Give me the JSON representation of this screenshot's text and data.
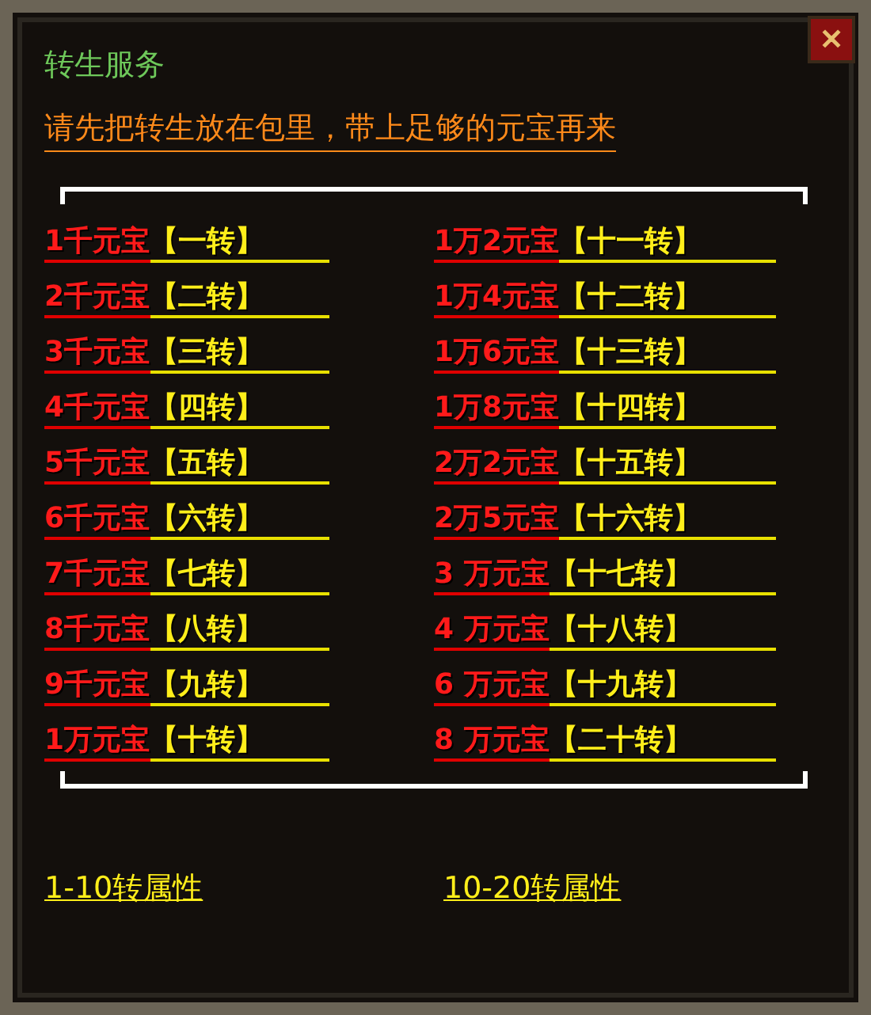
{
  "window": {
    "title": "转生服务",
    "close": "✕"
  },
  "notice": "请先把转生放在包里，带上足够的元宝再来",
  "columns": [
    [
      {
        "price": "1千元宝",
        "tier": "【一转】"
      },
      {
        "price": "2千元宝",
        "tier": "【二转】"
      },
      {
        "price": "3千元宝",
        "tier": "【三转】"
      },
      {
        "price": "4千元宝",
        "tier": "【四转】"
      },
      {
        "price": "5千元宝",
        "tier": "【五转】"
      },
      {
        "price": "6千元宝",
        "tier": "【六转】"
      },
      {
        "price": "7千元宝",
        "tier": "【七转】"
      },
      {
        "price": "8千元宝",
        "tier": "【八转】"
      },
      {
        "price": "9千元宝",
        "tier": "【九转】"
      },
      {
        "price": "1万元宝",
        "tier": "【十转】"
      }
    ],
    [
      {
        "price": "1万2元宝",
        "tier": "【十一转】"
      },
      {
        "price": "1万4元宝",
        "tier": "【十二转】"
      },
      {
        "price": "1万6元宝",
        "tier": "【十三转】"
      },
      {
        "price": "1万8元宝",
        "tier": "【十四转】"
      },
      {
        "price": "2万2元宝",
        "tier": "【十五转】"
      },
      {
        "price": "2万5元宝",
        "tier": "【十六转】"
      },
      {
        "price": "3 万元宝",
        "tier": "【十七转】"
      },
      {
        "price": "4 万元宝",
        "tier": "【十八转】"
      },
      {
        "price": "6 万元宝",
        "tier": "【十九转】"
      },
      {
        "price": "8 万元宝",
        "tier": "【二十转】"
      }
    ]
  ],
  "attribute_links": [
    "1-10转属性",
    "10-20转属性"
  ]
}
